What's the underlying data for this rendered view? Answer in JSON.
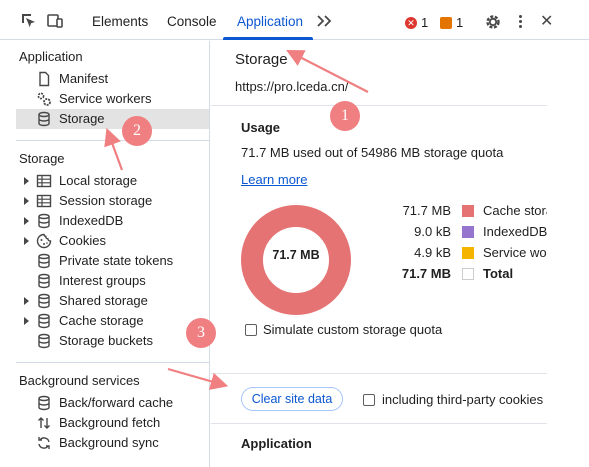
{
  "toolbar": {
    "tabs": [
      {
        "label": "Elements"
      },
      {
        "label": "Console"
      },
      {
        "label": "Application"
      }
    ],
    "error_count": "1",
    "warning_count": "1"
  },
  "sidebar": {
    "sections": [
      {
        "title": "Application",
        "items": [
          {
            "label": "Manifest",
            "icon": "document-icon"
          },
          {
            "label": "Service workers",
            "icon": "gears-icon"
          },
          {
            "label": "Storage",
            "icon": "database-icon",
            "selected": true
          }
        ]
      },
      {
        "title": "Storage",
        "items": [
          {
            "label": "Local storage",
            "icon": "table-icon",
            "expandable": true
          },
          {
            "label": "Session storage",
            "icon": "table-icon",
            "expandable": true
          },
          {
            "label": "IndexedDB",
            "icon": "database-icon",
            "expandable": true
          },
          {
            "label": "Cookies",
            "icon": "cookie-icon",
            "expandable": true
          },
          {
            "label": "Private state tokens",
            "icon": "database-icon"
          },
          {
            "label": "Interest groups",
            "icon": "database-icon"
          },
          {
            "label": "Shared storage",
            "icon": "database-icon",
            "expandable": true
          },
          {
            "label": "Cache storage",
            "icon": "database-icon",
            "expandable": true
          },
          {
            "label": "Storage buckets",
            "icon": "database-icon"
          }
        ]
      },
      {
        "title": "Background services",
        "items": [
          {
            "label": "Back/forward cache",
            "icon": "database-icon"
          },
          {
            "label": "Background fetch",
            "icon": "arrows-updown-icon"
          },
          {
            "label": "Background sync",
            "icon": "sync-icon"
          }
        ]
      }
    ]
  },
  "main": {
    "title": "Storage",
    "origin": "https://pro.lceda.cn/",
    "usage": {
      "title": "Usage",
      "text": "71.7 MB used out of 54986 MB storage quota",
      "learn_more": "Learn more",
      "donut_label": "71.7 MB",
      "legend": [
        {
          "value": "71.7 MB",
          "name": "Cache storage",
          "color": "#e57373"
        },
        {
          "value": "9.0 kB",
          "name": "IndexedDB",
          "color": "#9575cd"
        },
        {
          "value": "4.9 kB",
          "name": "Service workers",
          "color": "#f4b400"
        },
        {
          "value": "71.7 MB",
          "name": "Total",
          "color": "#ffffff"
        }
      ],
      "simulate_label": "Simulate custom storage quota"
    },
    "clear_button": "Clear site data",
    "third_party_label": "including third-party cookies",
    "application_title": "Application"
  },
  "annotations": {
    "markers": [
      "1",
      "2",
      "3"
    ],
    "color": "#f07f82"
  }
}
